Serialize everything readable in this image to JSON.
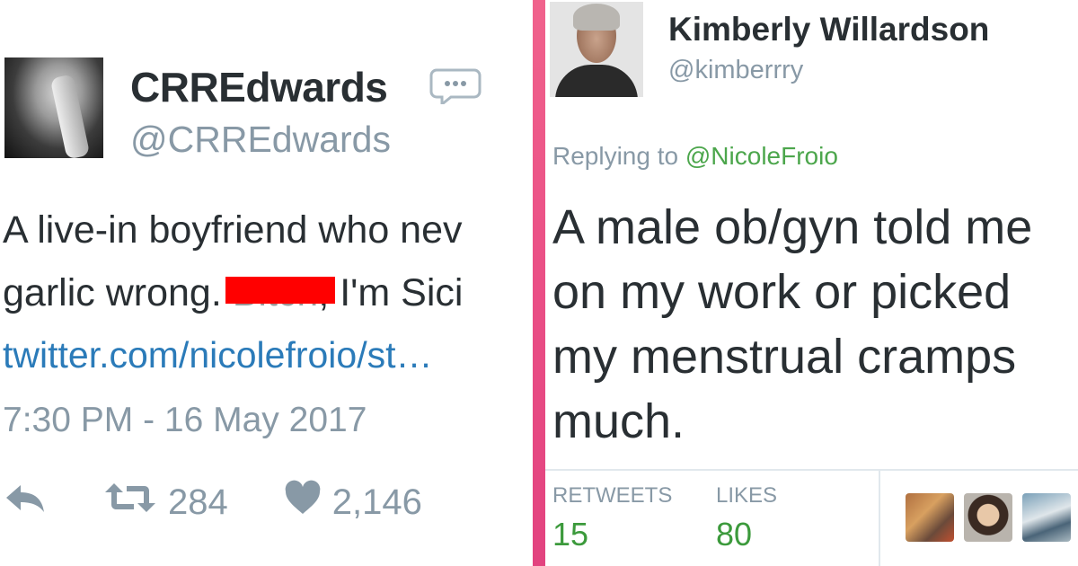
{
  "left_tweet": {
    "display_name": "CRREdwards",
    "handle": "@CRREdwards",
    "text_line1": "A live-in boyfriend who nev",
    "text_line2_start": "garlic wrong. ",
    "text_struck": "Bitch",
    "text_line2_end": ", I'm Sici",
    "link": "twitter.com/nicolefroio/st…",
    "timestamp": "7:30 PM - 16 May 2017",
    "retweets": "284",
    "likes": "2,146",
    "icons": [
      "reply-icon",
      "retweet-icon",
      "heart-icon",
      "speech-bubble-icon"
    ],
    "colors": {
      "redaction": "#ff0000",
      "link": "#2b7bb9",
      "muted": "#8899a6"
    }
  },
  "right_tweet": {
    "display_name": "Kimberly Willardson",
    "handle": "@kimberrry",
    "replying_prefix": "Replying to ",
    "replying_to": "@NicoleFroio",
    "text_lines": [
      "A male ob/gyn told me",
      "on my work or picked",
      "my menstrual cramps",
      "much."
    ],
    "retweets_label": "RETWEETS",
    "retweets_count": "15",
    "likes_label": "LIKES",
    "likes_count": "80",
    "colors": {
      "mention": "#4ca64c",
      "count": "#3c9a3c"
    }
  },
  "divider_color": "#ea4f86"
}
